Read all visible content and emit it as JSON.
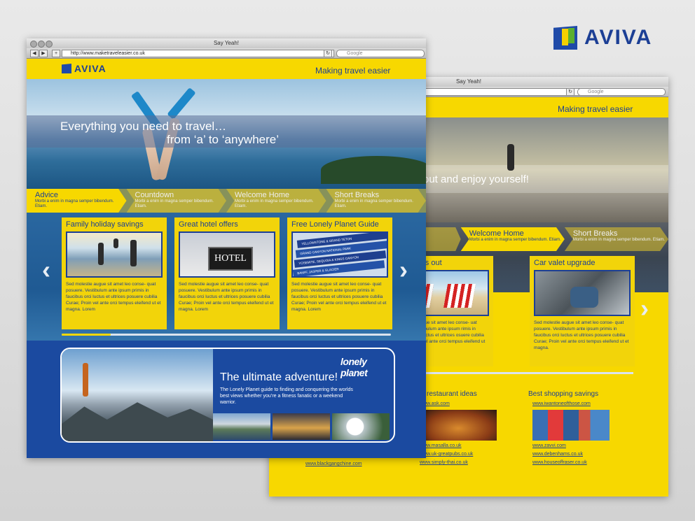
{
  "corner_logo": {
    "word": "AVIVA"
  },
  "back_window": {
    "title": "Say Yeah!",
    "search_placeholder": "Google",
    "tagline": "Making travel easier",
    "hero_text": "out and enjoy yourself!",
    "tabs": [
      {
        "label": "own",
        "desc": "",
        "state": "off"
      },
      {
        "label": "Welcome Home",
        "desc": "Morbi a enim in magna semper bibendum. Etiam.",
        "state": "on"
      },
      {
        "label": "Short Breaks",
        "desc": "Morbi a enim in magna semper bibendum. Etiam.",
        "state": "off"
      }
    ],
    "cards": [
      {
        "title": "for 1 days out",
        "text": "d molestie augue sit amet leo conse- uat posuere. Vestibulum ante ipsum rimis in faucibus orci luctus et ultrices osuere cubilia Curae; Proin vel ante orci tempus eleifend ut et magna."
      },
      {
        "title": "Car valet upgrade",
        "text": "Sed molestie augue sit amet leo conse- quat posuere. Vestibulum ante ipsum primis in faucibus orci luctus et ultrices posuere cubilia Curae; Proin vel ante orci tempus eleifend ut et magna."
      }
    ],
    "restaurant_heading": "w restaurant ideas",
    "restaurant_links": [
      "www.ask.com",
      "www.masalla.co.uk",
      "www.uk-greatpubs.co.uk",
      "www.simply-thai.co.uk"
    ],
    "shopping_heading": "Best shopping savings",
    "shopping_links": [
      "www.iwantoneofthose.com",
      "www.zavvi.com",
      "www.debenhams.co.uk",
      "www.houseoffraser.co.uk"
    ],
    "left_link": "www.blackgangchine.com"
  },
  "front_window": {
    "title": "Say Yeah!",
    "url": "http://www.maketraveleasier.co.uk",
    "search_placeholder": "Google",
    "logo_word": "AVIVA",
    "tagline": "Making travel easier",
    "hero_line1": "Everything you need to travel…",
    "hero_line2": "from ‘a’ to ‘anywhere’",
    "tabs": [
      {
        "label": "Advice",
        "desc": "Morbi a enim in magna semper bibendum. Etiam.",
        "state": "on"
      },
      {
        "label": "Countdown",
        "desc": "Morbi a enim in magna semper bibendum. Etiam.",
        "state": "off"
      },
      {
        "label": "Welcome Home",
        "desc": "Morbi a enim in magna semper bibendum. Etiam.",
        "state": "off"
      },
      {
        "label": "Short Breaks",
        "desc": "Morbi a enim in magna semper bibendum. Etiam.",
        "state": "off"
      }
    ],
    "cards": [
      {
        "title": "Family holiday savings",
        "text": "Sed molestie augue sit amet leo conse- quat posuere. Vestibulum ante ipsum primis in faucibus orci luctus et ultrices posuere cubilia Curae; Proin vel ante orci tempus eleifend ut et magna. Lorem"
      },
      {
        "title": "Great hotel offers",
        "text": "Sed molestie augue sit amet leo conse- quat posuere. Vestibulum ante ipsum primis in faucibus orci luctus et ultrices posuere cubilia Curae; Proin vel ante orci tempus eleifend ut et magna. Lorem",
        "sign": "HOTEL"
      },
      {
        "title": "Free Lonely Planet Guide",
        "text": "Sed molestie augue sit amet leo conse- quat posuere. Vestibulum ante ipsum primis in faucibus orci luctus et ultrices posuere cubilia Curae; Proin vel ante orci tempus eleifend ut et magna. Lorem",
        "books": [
          "YELLOWSTONE & GRAND TETON",
          "GRAND CANYON NATIONAL PARK",
          "YOSEMITE, SEQUOIA & KINGS CANYON",
          "BANFF, JASPER & GLACIER"
        ]
      }
    ],
    "prev_arrow": "‹",
    "next_arrow": "›",
    "adventure": {
      "brand": "lonely planet",
      "title": "The ultimate adventure!",
      "desc": "The Lonely Planet guide to finding and conquering the worlds best views whether you’re a fitness fanatic or a weekend warrior."
    }
  }
}
